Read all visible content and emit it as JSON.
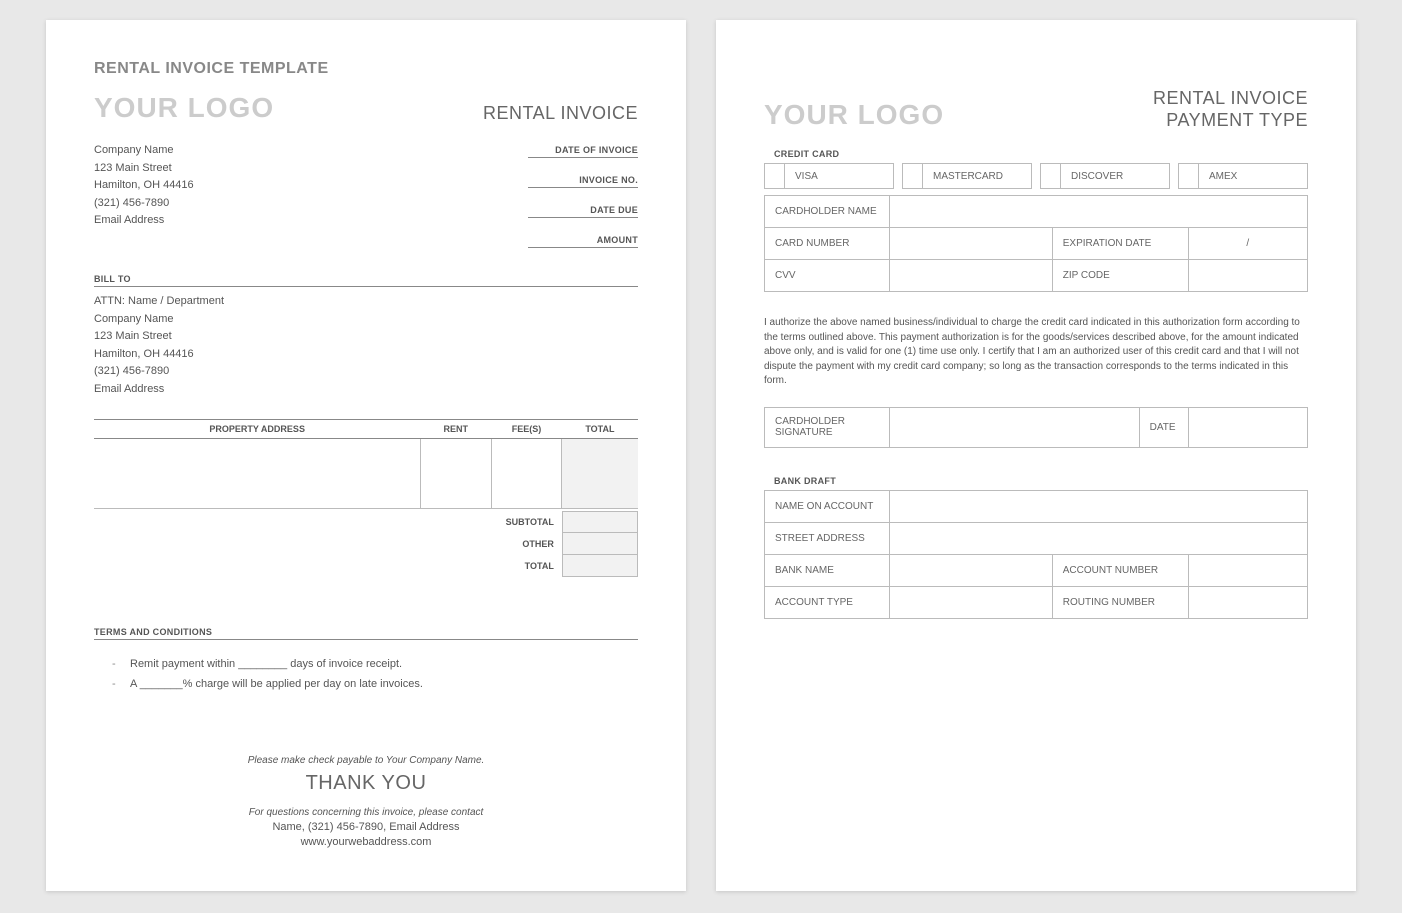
{
  "page1": {
    "template_title": "RENTAL INVOICE TEMPLATE",
    "logo": "YOUR LOGO",
    "doc_title": "RENTAL INVOICE",
    "company": {
      "name": "Company Name",
      "street": "123 Main Street",
      "city": "Hamilton, OH  44416",
      "phone": "(321) 456-7890",
      "email": "Email Address"
    },
    "meta": {
      "date_of_invoice": "DATE OF INVOICE",
      "invoice_no": "INVOICE NO.",
      "date_due": "DATE DUE",
      "amount": "AMOUNT"
    },
    "bill_to_label": "BILL TO",
    "bill_to": {
      "attn": "ATTN: Name / Department",
      "company": "Company Name",
      "street": "123 Main Street",
      "city": "Hamilton, OH  44416",
      "phone": "(321) 456-7890",
      "email": "Email Address"
    },
    "columns": {
      "addr": "PROPERTY ADDRESS",
      "rent": "RENT",
      "fees": "FEE(S)",
      "total": "TOTAL"
    },
    "totals": {
      "subtotal": "SUBTOTAL",
      "other": "OTHER",
      "total": "TOTAL"
    },
    "terms_header": "TERMS AND CONDITIONS",
    "terms": [
      "Remit payment within ________ days of invoice receipt.",
      "A _______% charge will be applied per day on late invoices."
    ],
    "footer": {
      "payable": "Please make check payable to Your Company Name.",
      "thanks": "THANK YOU",
      "contact_intro": "For questions concerning this invoice, please contact",
      "contact": "Name, (321) 456-7890, Email Address",
      "web": "www.yourwebaddress.com"
    }
  },
  "page2": {
    "logo": "YOUR LOGO",
    "doc_title_l1": "RENTAL INVOICE",
    "doc_title_l2": "PAYMENT TYPE",
    "credit_card_header": "CREDIT CARD",
    "cc_types": [
      "VISA",
      "MASTERCARD",
      "DISCOVER",
      "AMEX"
    ],
    "cc_fields": {
      "cardholder": "CARDHOLDER NAME",
      "card_number": "CARD NUMBER",
      "expiration": "EXPIRATION DATE",
      "exp_sep": "/",
      "cvv": "CVV",
      "zip": "ZIP CODE"
    },
    "auth_text": "I authorize the above named business/individual to charge the credit card indicated in this authorization form according to the terms outlined above. This payment authorization is for the goods/services described above, for the amount indicated above only, and is valid for one (1) time use only. I certify that I am an authorized user of this credit card and that I will not dispute the payment with my credit card company; so long as the transaction corresponds to the terms indicated in this form.",
    "signature": {
      "label": "CARDHOLDER SIGNATURE",
      "date": "DATE"
    },
    "bank_draft_header": "BANK DRAFT",
    "bank_fields": {
      "name": "NAME ON ACCOUNT",
      "street": "STREET ADDRESS",
      "bank_name": "BANK NAME",
      "account_number": "ACCOUNT NUMBER",
      "account_type": "ACCOUNT TYPE",
      "routing_number": "ROUTING NUMBER"
    }
  }
}
